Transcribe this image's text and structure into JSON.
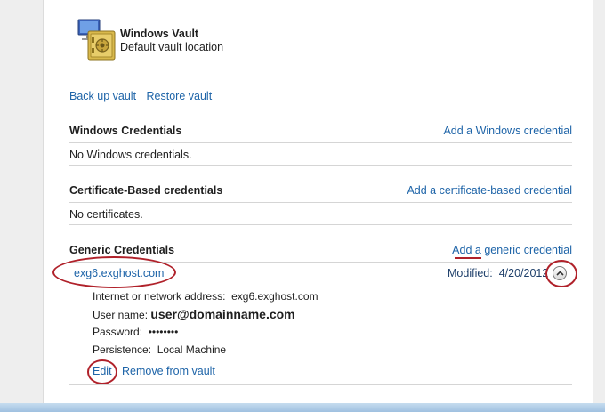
{
  "vault": {
    "title": "Windows Vault",
    "subtitle": "Default vault location",
    "backup_label": "Back up vault",
    "restore_label": "Restore vault"
  },
  "sections": {
    "windows": {
      "title": "Windows Credentials",
      "add_label": "Add a Windows credential",
      "empty_text": "No Windows credentials."
    },
    "certificate": {
      "title": "Certificate-Based credentials",
      "add_label": "Add a certificate-based credential",
      "empty_text": "No certificates."
    },
    "generic": {
      "title": "Generic Credentials",
      "add_label_a": "Add",
      "add_label_b": " a generic credential",
      "item": {
        "name": "exg6.exghost.com",
        "modified_label": "Modified:",
        "modified_date": "4/20/2012",
        "address_label": "Internet or network address:",
        "address_value": "exg6.exghost.com",
        "username_label": "User name:",
        "username_value": "user@domainname.com",
        "password_label": "Password:",
        "password_value": "••••••••",
        "persistence_label": "Persistence:",
        "persistence_value": "Local Machine",
        "edit_label": "Edit",
        "remove_label": "Remove from vault"
      }
    }
  },
  "icons": {
    "vault": "vault-safe-icon",
    "collapse": "chevron-up-icon"
  },
  "colors": {
    "link": "#1e64a8",
    "annotation": "#b0212a"
  }
}
